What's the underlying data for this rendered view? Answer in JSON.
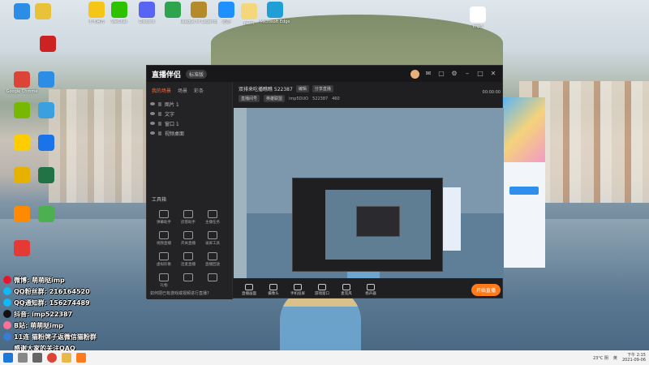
{
  "desktop": {
    "icons": [
      {
        "label": "",
        "color": "#2b8de5"
      },
      {
        "label": "",
        "color": "#e8c33a"
      },
      {
        "label": "卡卡官方",
        "color": "#f5c518"
      },
      {
        "label": "WeChat",
        "color": "#2dc100"
      },
      {
        "label": "Discord",
        "color": "#5865f2"
      },
      {
        "label": "",
        "color": "#2ea44f"
      },
      {
        "label": "League of Legends",
        "color": "#b58a2a"
      },
      {
        "label": "迅游",
        "color": "#1e90ff"
      },
      {
        "label": "paint",
        "color": "#f4d77a"
      },
      {
        "label": "Microsoft Edge",
        "color": "#1f9fd6"
      },
      {
        "label": "",
        "color": "#cc2222"
      },
      {
        "label": "imp5",
        "color": "#ffffff"
      },
      {
        "label": "Google Chrome",
        "color": "#db4437"
      },
      {
        "label": "",
        "color": "#2b8de5"
      },
      {
        "label": "",
        "color": "#76b900"
      },
      {
        "label": "",
        "color": "#3aa0e0"
      },
      {
        "label": "",
        "color": "#ffcc00"
      },
      {
        "label": "",
        "color": "#1a73e8"
      },
      {
        "label": "",
        "color": "#e7b100"
      },
      {
        "label": "",
        "color": "#217346"
      },
      {
        "label": "",
        "color": "#ff8a00"
      },
      {
        "label": "",
        "color": "#4caf50"
      },
      {
        "label": "",
        "color": "#e53935"
      }
    ]
  },
  "overlay": {
    "lines": [
      {
        "text": "微博: 萌萌哒imp",
        "color": "#e6162d"
      },
      {
        "text": "QQ粉丝群: 216164520",
        "color": "#12b7f5"
      },
      {
        "text": "QQ通知群: 156274489",
        "color": "#12b7f5"
      },
      {
        "text": "抖音: imp522387",
        "color": "#111111"
      },
      {
        "text": "B站: 萌萌哒imp",
        "color": "#fb7299"
      },
      {
        "text": "11连 猫粉牌子返微信猫粉群",
        "color": "#3a7bd5"
      },
      {
        "text": "感谢大家的关注QAQ",
        "color": "#3a7bd5"
      }
    ]
  },
  "app": {
    "logo": "直播伴侣",
    "version": "标准版",
    "sidebar": {
      "tabs": [
        "我的场景",
        "场景",
        "彩条"
      ],
      "scenes": [
        "图片 1",
        "文字",
        "窗口 1",
        "视频桌面"
      ],
      "tools_title": "工具箱",
      "tools": [
        "弹幕助手",
        "房管助手",
        "主播任务",
        "视频直播",
        "开关直播",
        "录屏工具",
        "虚拟形象",
        "连麦直播",
        "直播回放",
        "礼物",
        "",
        ""
      ],
      "tip": "如何把已有游戏或视频进行直播?"
    },
    "info": {
      "title": "双排来吃播瞧瞧 522387",
      "edit": "编辑",
      "share": "分享直播",
      "room": "直播间号",
      "category": "英雄联盟",
      "id": "imp5DUO",
      "uid": "522387",
      "fans": "460"
    },
    "controls": [
      "直播画面",
      "摄像头",
      "手机投屏",
      "游戏窗口",
      "麦克风",
      "扬声器"
    ],
    "go_live": "开始直播",
    "timer": "00:00:00"
  },
  "taskbar": {
    "weather": "23°C 阴",
    "lang": "英",
    "time": "下午 2:15",
    "date": "2021-09-06"
  }
}
